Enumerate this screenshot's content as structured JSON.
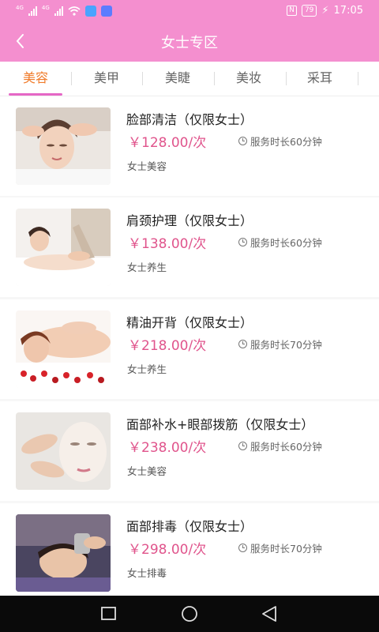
{
  "status_bar": {
    "left_small_1": "4G",
    "left_small_2": "4G",
    "time": "17:05",
    "nfc": "N",
    "battery": "79"
  },
  "header": {
    "title": "女士专区"
  },
  "tabs": [
    {
      "label": "美容",
      "active": true
    },
    {
      "label": "美甲",
      "active": false
    },
    {
      "label": "美睫",
      "active": false
    },
    {
      "label": "美妆",
      "active": false
    },
    {
      "label": "采耳",
      "active": false
    }
  ],
  "services": [
    {
      "name": "脸部清洁（仅限女士）",
      "price": "￥128.00/次",
      "duration": "服务时长60分钟",
      "category": "女士美容"
    },
    {
      "name": "肩颈护理（仅限女士）",
      "price": "￥138.00/次",
      "duration": "服务时长60分钟",
      "category": "女士养生"
    },
    {
      "name": "精油开背（仅限女士）",
      "price": "￥218.00/次",
      "duration": "服务时长70分钟",
      "category": "女士养生"
    },
    {
      "name": "面部补水+眼部拨筋（仅限女士）",
      "price": "￥238.00/次",
      "duration": "服务时长60分钟",
      "category": "女士美容"
    },
    {
      "name": "面部排毒（仅限女士）",
      "price": "￥298.00/次",
      "duration": "服务时长70分钟",
      "category": "女士排毒"
    }
  ],
  "colors": {
    "brand_pink": "#f48fcf",
    "price": "#e0548c",
    "active_tab": "#f07b2a",
    "tab_indicator": "#e567c6"
  }
}
